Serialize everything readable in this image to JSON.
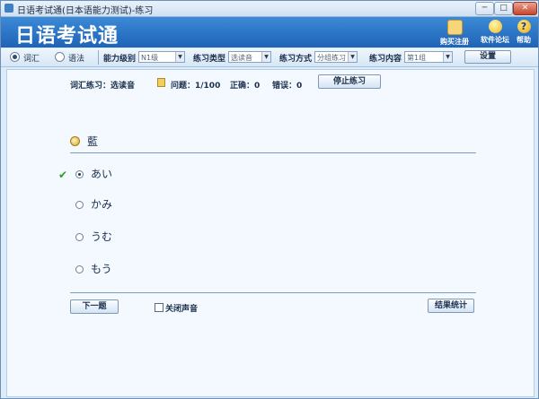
{
  "window": {
    "title": "日语考试通(日本语能力测试)-练习",
    "min_label": "─",
    "max_label": "□",
    "close_label": "✕"
  },
  "banner": {
    "title": "日语考试通",
    "tools": [
      {
        "label": "购买注册",
        "icon": "cart-icon"
      },
      {
        "label": "软件论坛",
        "icon": "lightbulb-icon"
      },
      {
        "label": "帮助",
        "icon": "help-icon",
        "glyph": "?"
      }
    ]
  },
  "filters": {
    "modes": [
      {
        "label": "词汇",
        "checked": true
      },
      {
        "label": "语法",
        "checked": false
      }
    ],
    "level": {
      "label": "能力级别",
      "value": "N1级"
    },
    "type": {
      "label": "练习类型",
      "value": "选读音"
    },
    "method": {
      "label": "练习方式",
      "value": "分组练习"
    },
    "content": {
      "label": "练习内容",
      "value": "第1组"
    },
    "settings_label": "设置"
  },
  "status": {
    "mode": "词汇练习：选读音",
    "question": "问题：1/100",
    "correct": "正确：0",
    "wrong": "错误：0",
    "stop_label": "停止练习"
  },
  "question": {
    "word": "藍",
    "options": [
      {
        "text": "あい",
        "checked": true,
        "correct": true
      },
      {
        "text": "かみ",
        "checked": false,
        "correct": false
      },
      {
        "text": "うむ",
        "checked": false,
        "correct": false
      },
      {
        "text": "もう",
        "checked": false,
        "correct": false
      }
    ],
    "correct_mark": "✔"
  },
  "footer": {
    "next_label": "下一题",
    "mute_label": "关闭声音",
    "mute_checked": false,
    "stats_label": "结果统计"
  }
}
